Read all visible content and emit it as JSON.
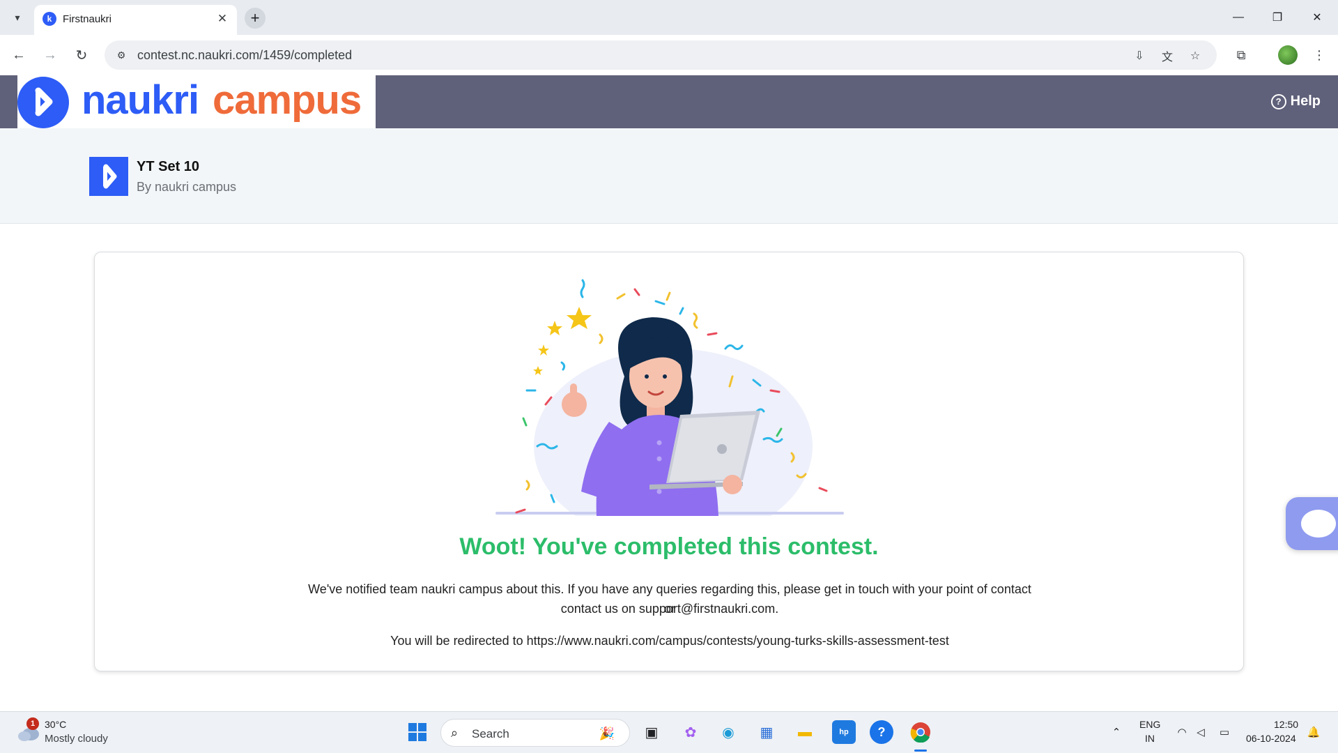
{
  "browser": {
    "tab_title": "Firstnaukri",
    "new_tab_symbol": "+",
    "url": "contest.nc.naukri.com/1459/completed",
    "favicon_letter": "k"
  },
  "header": {
    "logo_word1": "naukri",
    "logo_word2": "campus",
    "help_label": "Help",
    "help_icon_glyph": "?",
    "bar_color": "#5f6079",
    "brand_blue": "#2d5cf6",
    "brand_orange": "#ef6b3a"
  },
  "contest": {
    "title": "YT Set 10",
    "by_line": "By naukri campus"
  },
  "card": {
    "heading": "Woot! You've completed this contest.",
    "heading_color": "#2cbd6a",
    "message_line1": "We've notified team naukri campus about this. If you have any queries regarding this, please get in touch with your point of contact or",
    "message_line2": "contact us on support@firstnaukri.com.",
    "redirect_text": "You will be redirected to https://www.naukri.com/campus/contests/young-turks-skills-assessment-test"
  },
  "taskbar": {
    "weather_temp": "30°C",
    "weather_desc": "Mostly cloudy",
    "weather_badge": "1",
    "search_label": "Search",
    "lang_line1": "ENG",
    "lang_line2": "IN",
    "time": "12:50",
    "date": "06-10-2024"
  }
}
